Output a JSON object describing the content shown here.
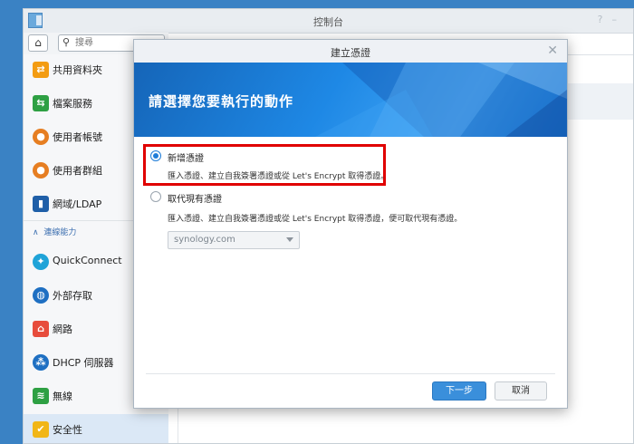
{
  "window": {
    "title": "控制台"
  },
  "toolbar": {
    "home_icon": "home-icon",
    "search_placeholder": "搜尋"
  },
  "sidebar": {
    "items": [
      {
        "label": "共用資料夾",
        "icon": "folder-share-icon",
        "color": "#f39c12"
      },
      {
        "label": "檔案服務",
        "icon": "file-services-icon",
        "color": "#2ea043"
      },
      {
        "label": "使用者帳號",
        "icon": "user-icon",
        "color": "#e67e22"
      },
      {
        "label": "使用者群組",
        "icon": "user-group-icon",
        "color": "#e67e22"
      },
      {
        "label": "網域/LDAP",
        "icon": "domain-ldap-icon",
        "color": "#1f5fa8"
      }
    ],
    "section_label": "連線能力",
    "connectivity_items": [
      {
        "label": "QuickConnect",
        "icon": "quickconnect-icon",
        "color": "#1fa3d8"
      },
      {
        "label": "外部存取",
        "icon": "globe-icon",
        "color": "#1e6fc2"
      },
      {
        "label": "網路",
        "icon": "network-home-icon",
        "color": "#e74c3c"
      },
      {
        "label": "DHCP 伺服器",
        "icon": "dhcp-icon",
        "color": "#1e6fc2"
      },
      {
        "label": "無線",
        "icon": "wifi-icon",
        "color": "#2ea043"
      },
      {
        "label": "安全性",
        "icon": "shield-icon",
        "color": "#f1b617"
      }
    ],
    "active": "安全性"
  },
  "dialog": {
    "title": "建立憑證",
    "banner_heading": "請選擇您要執行的動作",
    "options": [
      {
        "label": "新增憑證",
        "description": "匯入憑證、建立自我簽署憑證或從 Let's Encrypt 取得憑證。",
        "checked": true
      },
      {
        "label": "取代現有憑證",
        "description": "匯入憑證、建立自我簽署憑證或從 Let's Encrypt 取得憑證，便可取代現有憑證。",
        "checked": false
      }
    ],
    "select_value": "synology.com",
    "next_button": "下一步",
    "cancel_button": "取消"
  },
  "watermark": "minwt.com",
  "colors": {
    "accent": "#3a8fdb",
    "banner": "#1e88e5",
    "highlight_box": "#e00000",
    "desktop": "#3a82c4"
  }
}
